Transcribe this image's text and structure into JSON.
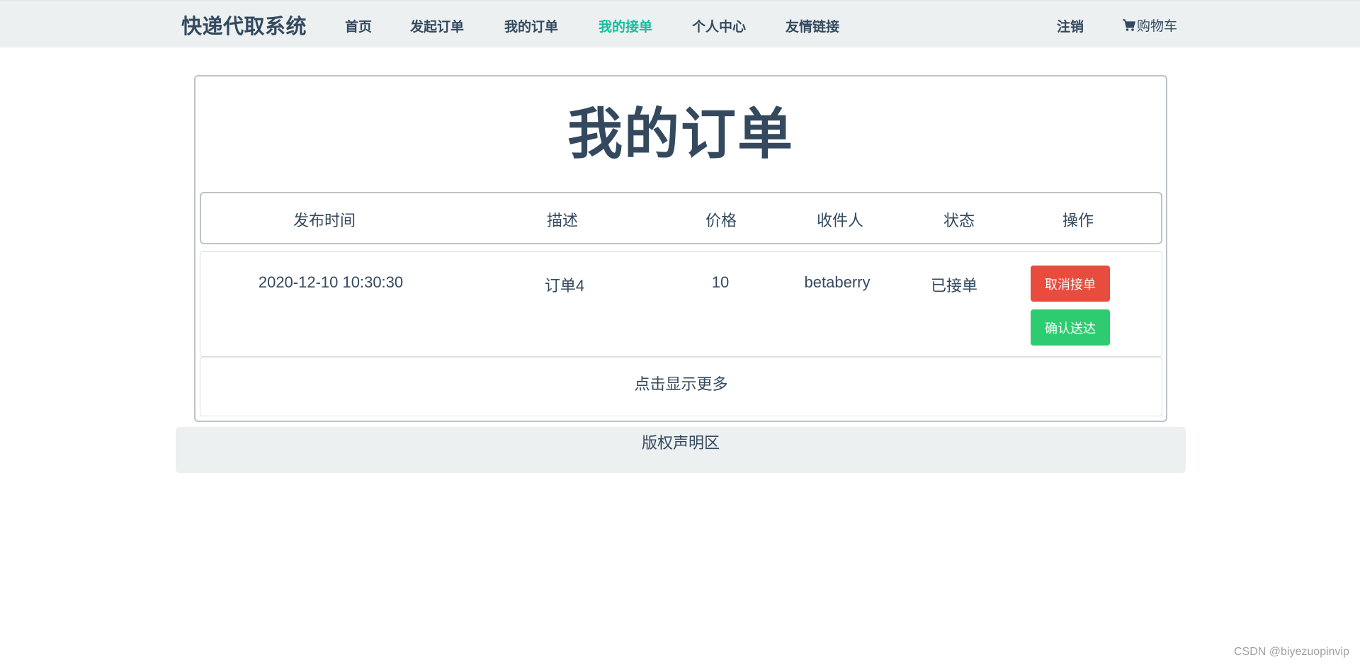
{
  "navbar": {
    "brand": "快递代取系统",
    "items": [
      {
        "label": "首页",
        "active": false
      },
      {
        "label": "发起订单",
        "active": false
      },
      {
        "label": "我的订单",
        "active": false
      },
      {
        "label": "我的接单",
        "active": true
      },
      {
        "label": "个人中心",
        "active": false
      },
      {
        "label": "友情链接",
        "active": false
      }
    ],
    "logout": "注销",
    "cart": {
      "icon": "cart-icon",
      "label": "购物车"
    }
  },
  "page": {
    "title": "我的订单"
  },
  "table": {
    "columns": [
      "发布时间",
      "描述",
      "价格",
      "收件人",
      "状态",
      "操作"
    ],
    "rows": [
      {
        "time": "2020-12-10 10:30:30",
        "description": "订单4",
        "price": "10",
        "recipient": "betaberry",
        "status": "已接单",
        "actions": {
          "cancel": "取消接单",
          "confirm": "确认送达"
        }
      }
    ],
    "more": "点击显示更多"
  },
  "footer": {
    "text": "版权声明区"
  },
  "watermark": "CSDN @biyezuopinvip",
  "colors": {
    "primary_text": "#34495e",
    "active_nav": "#1abc9c",
    "navbar_bg": "#ecf0f1",
    "cancel_button": "#e74c3c",
    "confirm_button": "#2ecc71"
  }
}
